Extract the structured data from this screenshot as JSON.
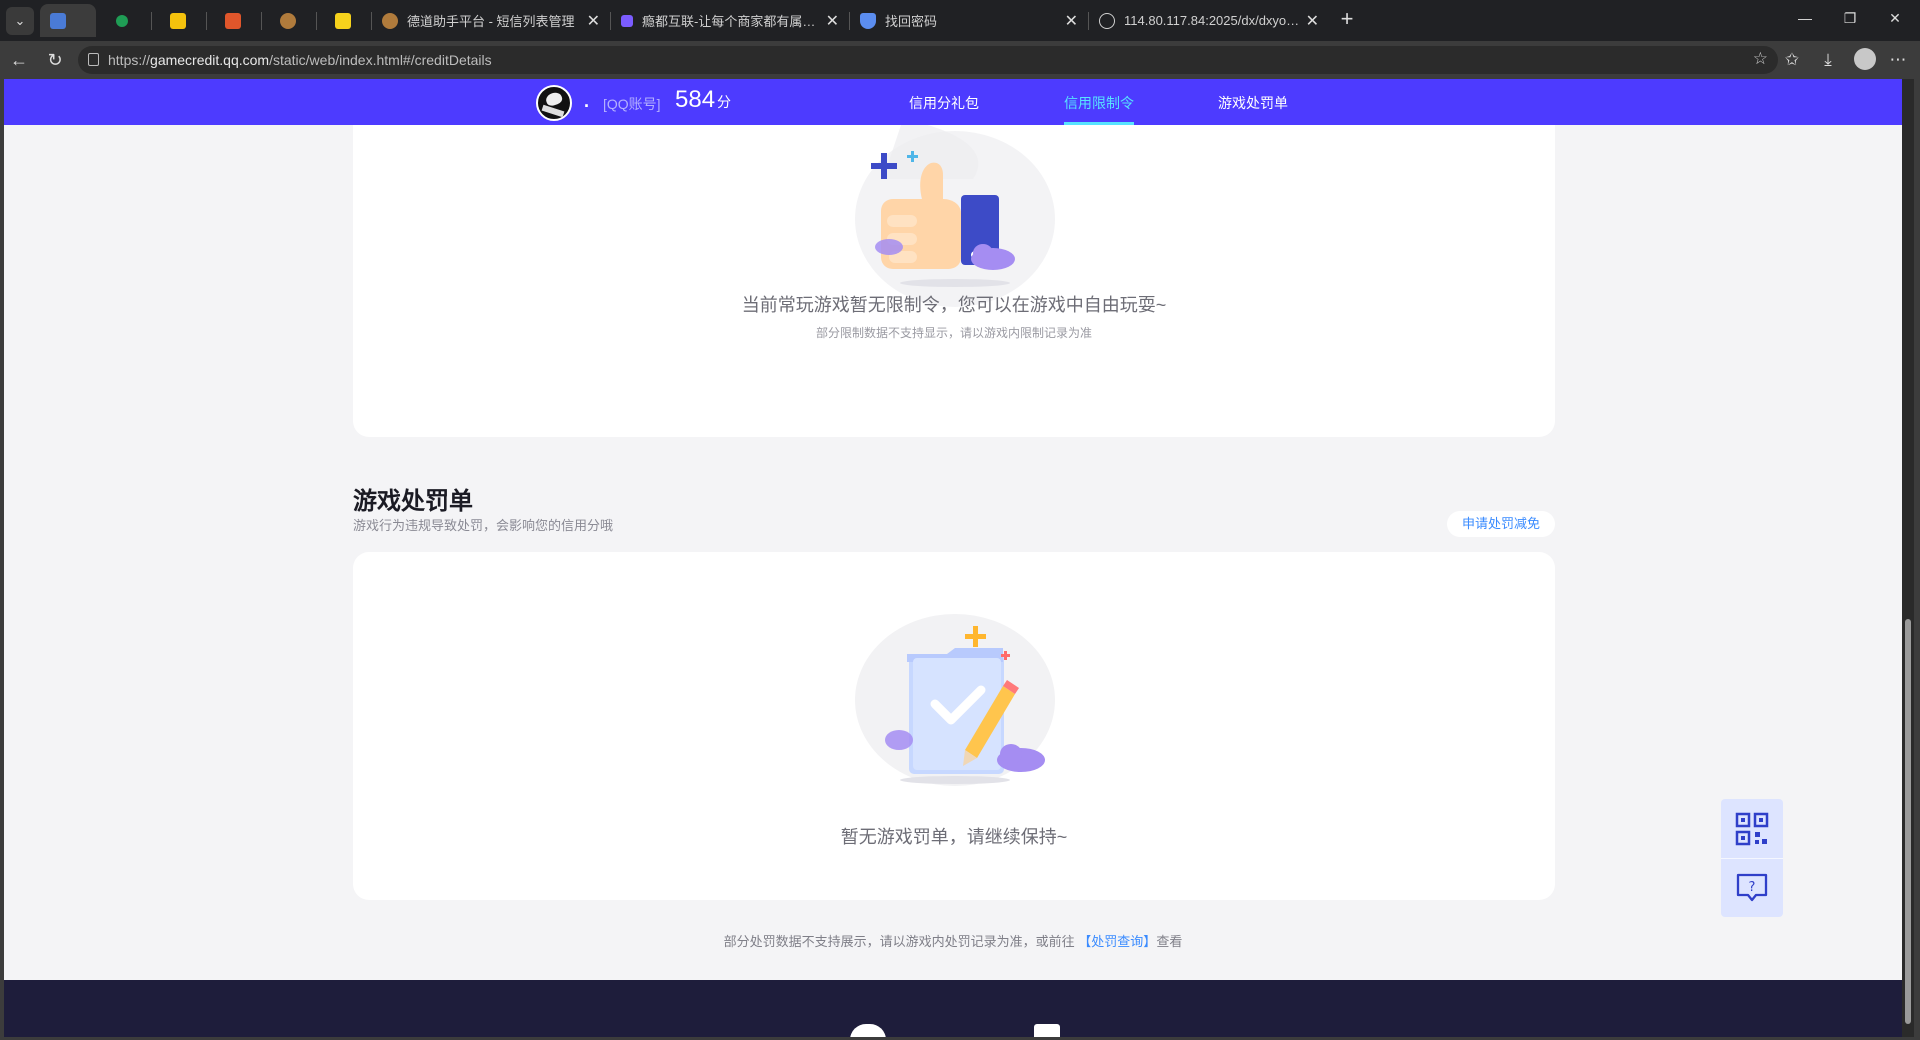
{
  "browser": {
    "tabs": [
      {
        "title": "",
        "favicon_color": "#4a7bd6",
        "active": true
      },
      {
        "title": "",
        "favicon_color": "#1f9d55",
        "active": false
      },
      {
        "title": "",
        "favicon_color": "#f4c20d",
        "active": false
      },
      {
        "title": "",
        "favicon_color": "#e0562b",
        "active": false
      },
      {
        "title": "",
        "favicon_color": "#b07b3c",
        "active": false
      },
      {
        "title": "",
        "favicon_color": "#f6d21c",
        "active": false
      },
      {
        "title": "德道助手平台 - 短信列表管理",
        "favicon_color": "#b07b3c",
        "active": false
      },
      {
        "title": "瘾都互联-让每个商家都有属于自己",
        "favicon_color": "#7b5cff",
        "active": false
      },
      {
        "title": "找回密码",
        "favicon_color": "#5b8def",
        "active": false
      },
      {
        "title": "114.80.117.84:2025/dx/dxyonghuo",
        "favicon_color": "#d0d0d0",
        "active": false
      }
    ],
    "url_prefix": "https://",
    "url_host": "gamecredit.qq.com",
    "url_path": "/static/web/index.html#/creditDetails"
  },
  "site": {
    "nickname": ".",
    "account_label": "[QQ账号]",
    "score": "584",
    "score_unit": "分",
    "nav": [
      {
        "label": "信用分礼包",
        "active": false
      },
      {
        "label": "信用限制令",
        "active": true
      },
      {
        "label": "游戏处罚单",
        "active": false
      }
    ]
  },
  "restriction": {
    "empty_text": "当前常玩游戏暂无限制令，您可以在游戏中自由玩耍~",
    "note": "部分限制数据不支持显示，请以游戏内限制记录为准"
  },
  "penalty": {
    "title": "游戏处罚单",
    "desc": "游戏行为违规导致处罚，会影响您的信用分哦",
    "apply_button": "申请处罚减免",
    "empty_text": "暂无游戏罚单，请继续保持~",
    "footnote_before": "部分处罚数据不支持展示，请以游戏内处罚记录为准，或前往",
    "footnote_link": "【处罚查询】",
    "footnote_after": "查看"
  },
  "floating": {
    "icons": [
      "qrcode-icon",
      "feedback-icon"
    ]
  },
  "colors": {
    "brand_bar": "#4d3bff",
    "active_nav": "#57e3ff",
    "link": "#3a8bff",
    "footer": "#1e1d3b"
  }
}
